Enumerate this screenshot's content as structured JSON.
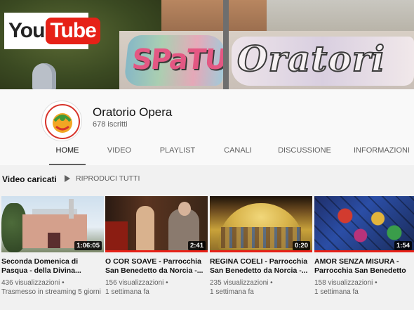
{
  "logo": {
    "you": "You",
    "tube": "Tube"
  },
  "channel": {
    "name": "Oratorio Opera",
    "subscribers": "678 iscritti"
  },
  "tabs": [
    {
      "label": "HOME",
      "active": true
    },
    {
      "label": "VIDEO",
      "active": false
    },
    {
      "label": "PLAYLIST",
      "active": false
    },
    {
      "label": "CANALI",
      "active": false
    },
    {
      "label": "DISCUSSIONE",
      "active": false
    },
    {
      "label": "INFORMAZIONI",
      "active": false
    }
  ],
  "uploads": {
    "title": "Video caricati",
    "play_all": "RIPRODUCI TUTTI",
    "videos": [
      {
        "duration": "1:06:05",
        "title": "Seconda Domenica di Pasqua - della Divina...",
        "views": "436 visualizzazioni •",
        "time": "Trasmesso in streaming 5 giorni",
        "watched_fraction": 0
      },
      {
        "duration": "2:41",
        "title": "O COR SOAVE - Parrocchia San Benedetto da Norcia -...",
        "views": "156 visualizzazioni •",
        "time": "1 settimana fa",
        "watched_fraction": 1
      },
      {
        "duration": "0:20",
        "title": "REGINA COELI - Parrocchia San Benedetto da Norcia -...",
        "views": "235 visualizzazioni •",
        "time": "1 settimana fa",
        "watched_fraction": 1
      },
      {
        "duration": "1:54",
        "title": "AMOR SENZA MISURA - Parrocchia San Benedetto d...",
        "views": "158 visualizzazioni •",
        "time": "1 settimana fa",
        "watched_fraction": 1
      }
    ]
  },
  "colors": {
    "accent_red": "#e62117",
    "text_primary": "#111111",
    "text_secondary": "#606060"
  }
}
